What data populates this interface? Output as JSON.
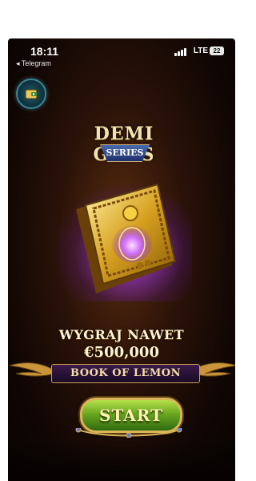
{
  "status_bar": {
    "time": "18:11",
    "back_app": "◂ Telegram",
    "network": "LTE",
    "battery": "22"
  },
  "game": {
    "logo_main": "DEMI GODS",
    "logo_sub": "SERIES",
    "win_line": "WYGRAJ NAWET",
    "win_amount": "€500,000",
    "title": "BOOK OF LEMON",
    "start_label": "START"
  },
  "colors": {
    "accent_gold": "#d9b55a",
    "start_green": "#6aa820",
    "glow_purple": "#c060ff"
  },
  "icons": {
    "wallet": "wallet-icon",
    "signal": "signal-icon"
  }
}
